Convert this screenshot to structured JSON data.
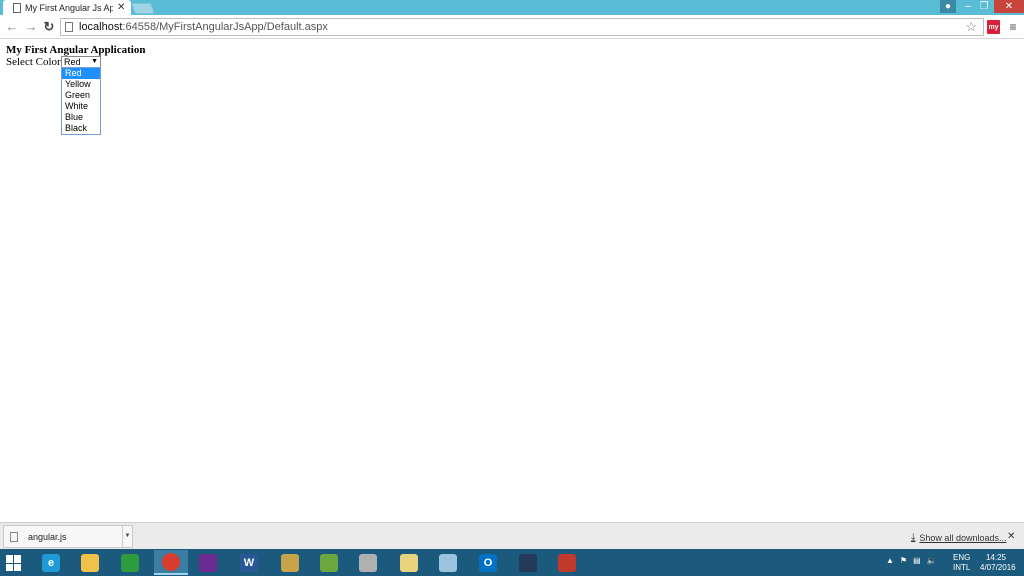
{
  "browser": {
    "tab_title": "My First Angular Js Applic",
    "url_host": "localhost",
    "url_rest": ":64558/MyFirstAngularJsApp/Default.aspx",
    "extension_label": "my"
  },
  "page": {
    "heading": "My First Angular Application",
    "select_label": "Select Color:",
    "selected_value": "Red",
    "options": [
      "Red",
      "Yellow",
      "Green",
      "White",
      "Blue",
      "Black"
    ]
  },
  "downloads": {
    "file_name": "angular.js",
    "show_all_label": "Show all downloads..."
  },
  "taskbar": {
    "apps": [
      {
        "name": "internet-explorer",
        "label": "e",
        "color": "#1e9bd7"
      },
      {
        "name": "file-explorer",
        "label": "",
        "color": "#f2c14a"
      },
      {
        "name": "store",
        "label": "",
        "color": "#2e9b3e"
      },
      {
        "name": "chrome",
        "label": "",
        "color": "#d93d2f"
      },
      {
        "name": "visual-studio",
        "label": "",
        "color": "#6a2c91"
      },
      {
        "name": "word",
        "label": "W",
        "color": "#2b5797"
      },
      {
        "name": "tools",
        "label": "",
        "color": "#c7a44a"
      },
      {
        "name": "paint",
        "label": "",
        "color": "#6ca63e"
      },
      {
        "name": "search-tool",
        "label": "",
        "color": "#b0b0b0"
      },
      {
        "name": "folder",
        "label": "",
        "color": "#e7d47c"
      },
      {
        "name": "notes",
        "label": "",
        "color": "#9bc3e0"
      },
      {
        "name": "outlook",
        "label": "O",
        "color": "#0072c6"
      },
      {
        "name": "app-dark",
        "label": "",
        "color": "#243a5a"
      },
      {
        "name": "app-red",
        "label": "",
        "color": "#c0392b"
      }
    ],
    "lang_top": "ENG",
    "lang_bottom": "INTL",
    "time": "14:25",
    "date": "4/07/2016"
  }
}
